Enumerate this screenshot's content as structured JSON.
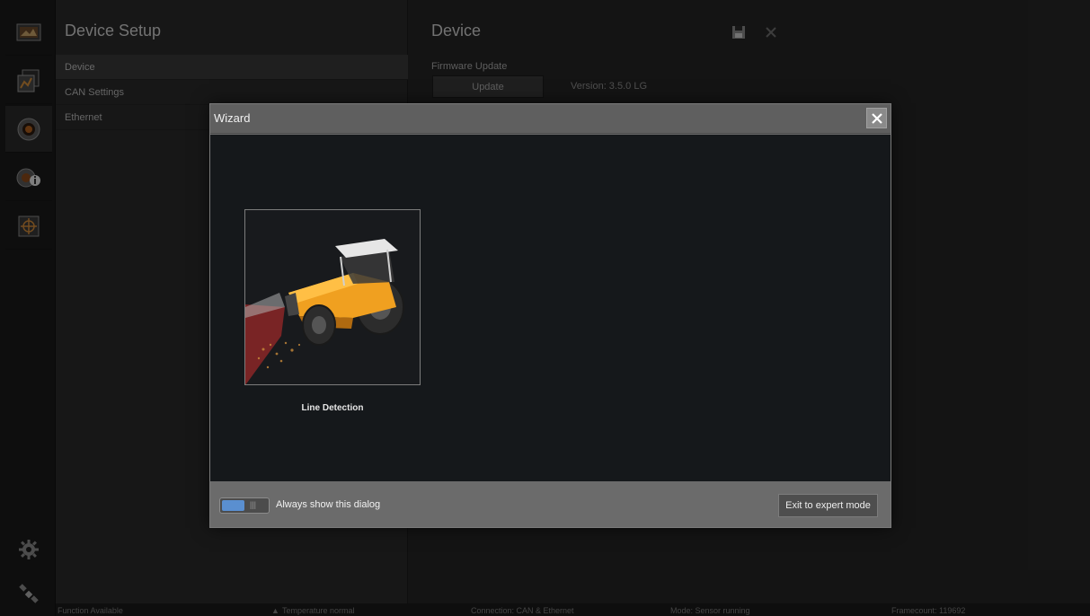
{
  "sidebar": {
    "icons": [
      {
        "name": "monitor-icon"
      },
      {
        "name": "chart-icon"
      },
      {
        "name": "sensor-icon"
      },
      {
        "name": "sensor-info-icon"
      },
      {
        "name": "crosshair-icon"
      }
    ],
    "bottom_icons": [
      {
        "name": "gear-icon"
      },
      {
        "name": "satellite-icon"
      }
    ]
  },
  "setup": {
    "title": "Device Setup",
    "items": [
      {
        "label": "Device"
      },
      {
        "label": "CAN Settings"
      },
      {
        "label": "Ethernet"
      }
    ]
  },
  "device": {
    "title": "Device",
    "firmware_label": "Firmware Update",
    "update_button": "Update",
    "version": "Version: 3.5.0 LG"
  },
  "wizard": {
    "title": "Wizard",
    "tile_label": "Line Detection",
    "always_show_label": "Always show this dialog",
    "toggle_grip": "|||",
    "expert_button": "Exit to expert mode",
    "always_show_on": true
  },
  "statusbar": {
    "function": "Function Available",
    "temperature": "Temperature normal",
    "connection": "Connection: CAN & Ethernet",
    "mode": "Mode: Sensor running",
    "framecount": "Framecount: 119692"
  },
  "colors": {
    "accent_toggle": "#5a8fd0",
    "tractor_orange": "#f0a020",
    "laser_red": "#c03030"
  }
}
